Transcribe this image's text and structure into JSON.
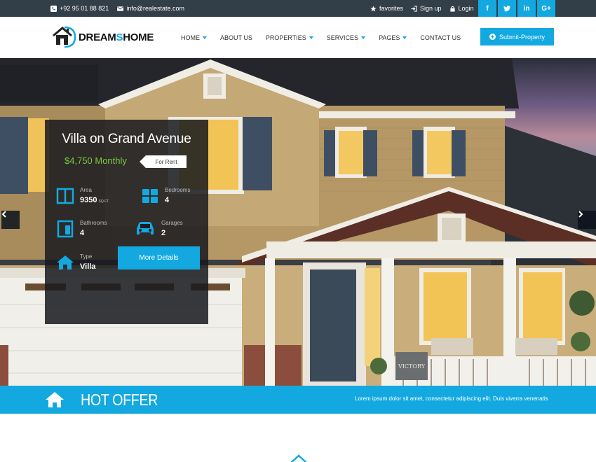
{
  "topbar": {
    "phone": "+92 95 01 88 821",
    "email": "info@realestate.com",
    "favorites_label": "favorites",
    "signup_label": "Sign up",
    "login_label": "Login",
    "socials": [
      "f",
      "t",
      "in",
      "G+"
    ]
  },
  "header": {
    "logo_part1": "DREAM",
    "logo_separator": "S",
    "logo_part2": "HOME",
    "nav": [
      {
        "label": "HOME",
        "dropdown": true
      },
      {
        "label": "ABOUT US",
        "dropdown": false
      },
      {
        "label": "PROPERTIES",
        "dropdown": true
      },
      {
        "label": "SERVICES",
        "dropdown": true
      },
      {
        "label": "PAGES",
        "dropdown": true
      },
      {
        "label": "CONTACT US",
        "dropdown": false
      }
    ],
    "submit_label": "Submit-Property"
  },
  "hero": {
    "prev_icon": "chevron-left-icon",
    "next_icon": "chevron-right-icon",
    "house_plaque": "VICTORY"
  },
  "property": {
    "title": "Villa on Grand Avenue",
    "price": "$4,750 Monthly",
    "tag": "For Rent",
    "area_label": "Area",
    "area_value": "9350",
    "area_unit": "SQ FT",
    "bedrooms_label": "Bedrooms",
    "bedrooms_value": "4",
    "bathrooms_label": "Bathrooms",
    "bathrooms_value": "4",
    "garages_label": "Garages",
    "garages_value": "2",
    "type_label": "Type",
    "type_value": "Villa",
    "details_label": "More Details"
  },
  "hot_offer": {
    "title": "HOT OFFER",
    "marquee": "Lorem ipsum dolor sit amet, consectetur adipiscing elit. Duis viverra venenatis"
  },
  "colors": {
    "accent": "#13a9e0",
    "topbar": "#323e48",
    "price": "#7ac943"
  }
}
